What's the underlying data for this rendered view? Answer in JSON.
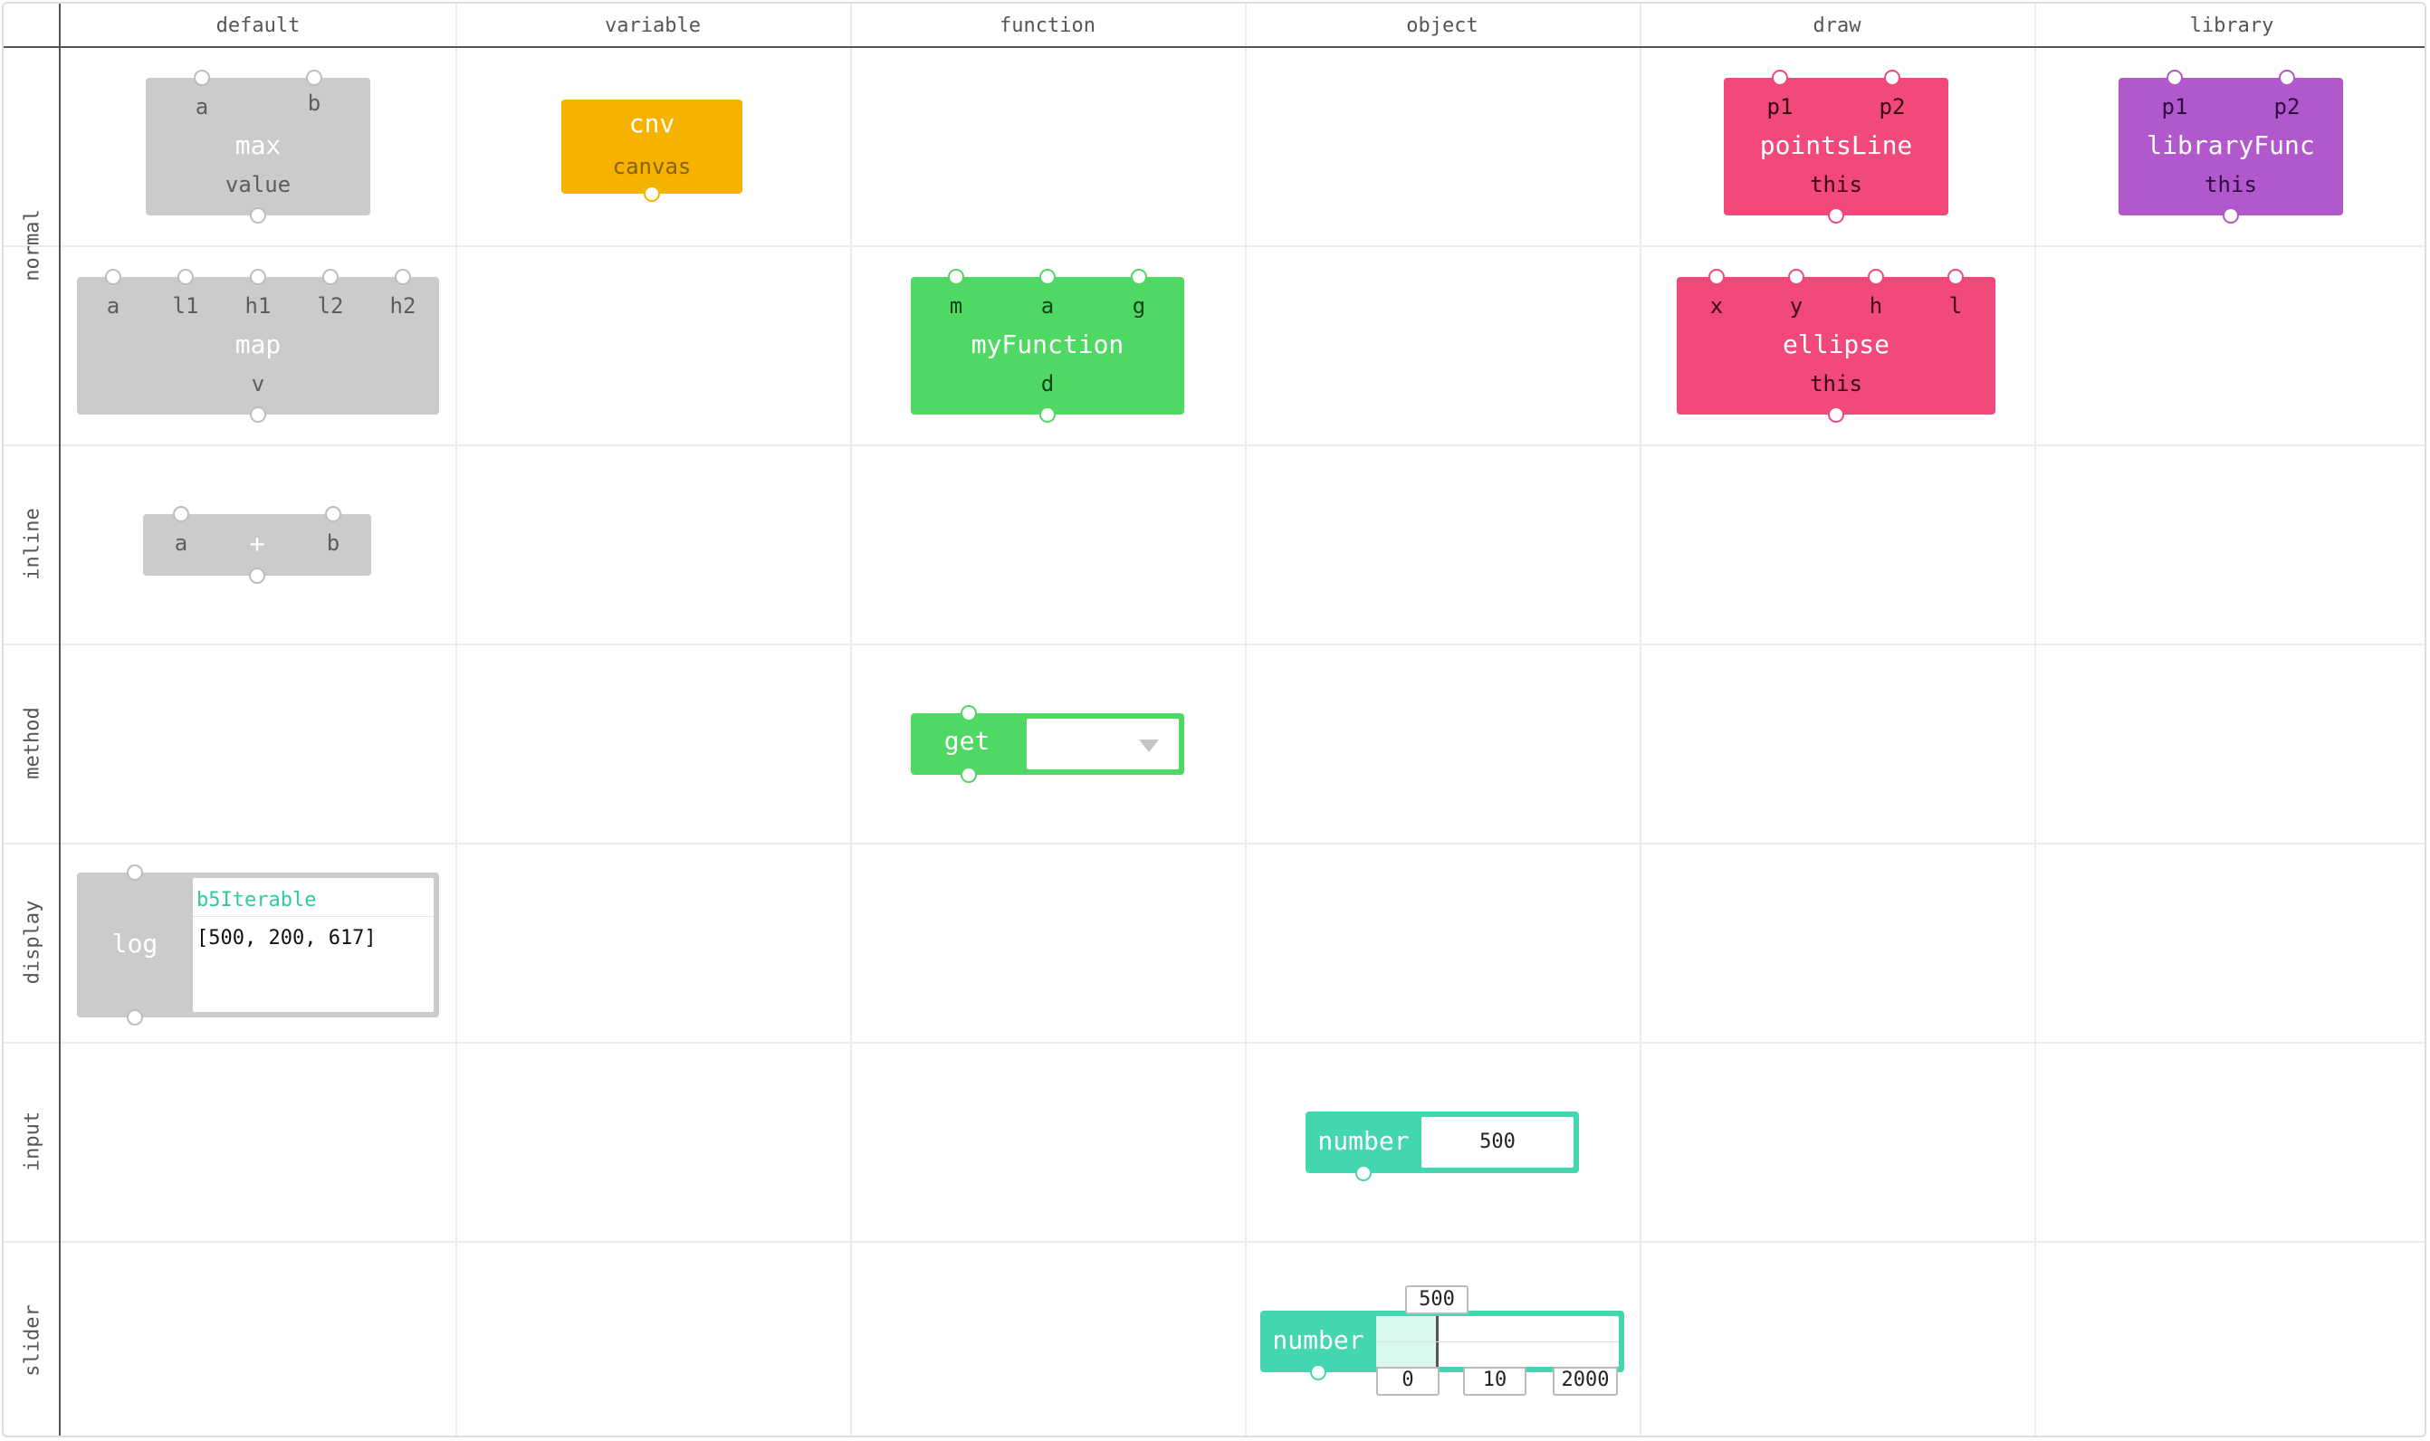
{
  "columns": [
    "default",
    "variable",
    "function",
    "object",
    "draw",
    "library"
  ],
  "rows": [
    "normal",
    "inline",
    "method",
    "display",
    "input",
    "slider"
  ],
  "blocks": {
    "max": {
      "inputs": [
        "a",
        "b"
      ],
      "name": "max",
      "output": "value"
    },
    "cnv": {
      "name": "cnv",
      "output": "canvas"
    },
    "pointsLine": {
      "inputs": [
        "p1",
        "p2"
      ],
      "name": "pointsLine",
      "output": "this"
    },
    "libraryFunc": {
      "inputs": [
        "p1",
        "p2"
      ],
      "name": "libraryFunc",
      "output": "this"
    },
    "map": {
      "inputs": [
        "a",
        "l1",
        "h1",
        "l2",
        "h2"
      ],
      "name": "map",
      "output": "v"
    },
    "myFunction": {
      "inputs": [
        "m",
        "a",
        "g"
      ],
      "name": "myFunction",
      "output": "d"
    },
    "ellipse": {
      "inputs": [
        "x",
        "y",
        "h",
        "l"
      ],
      "name": "ellipse",
      "output": "this"
    },
    "add": {
      "inputs": [
        "a",
        "b"
      ],
      "operator": "+"
    },
    "get": {
      "name": "get",
      "selected": ""
    },
    "log": {
      "name": "log",
      "type": "b5Iterable",
      "value": "[500, 200, 617]"
    },
    "number_input": {
      "name": "number",
      "value": "500"
    },
    "number_slider": {
      "name": "number",
      "value": "500",
      "min": "0",
      "step": "10",
      "max": "2000",
      "fraction": 0.25
    }
  },
  "colors": {
    "default": "#cbcbcb",
    "variable": "#f5b300",
    "function": "#4fd863",
    "draw": "#f0497a",
    "library": "#b159cc",
    "object": "#44d6b0"
  },
  "icons": {
    "dropdown": "triangle-down"
  }
}
